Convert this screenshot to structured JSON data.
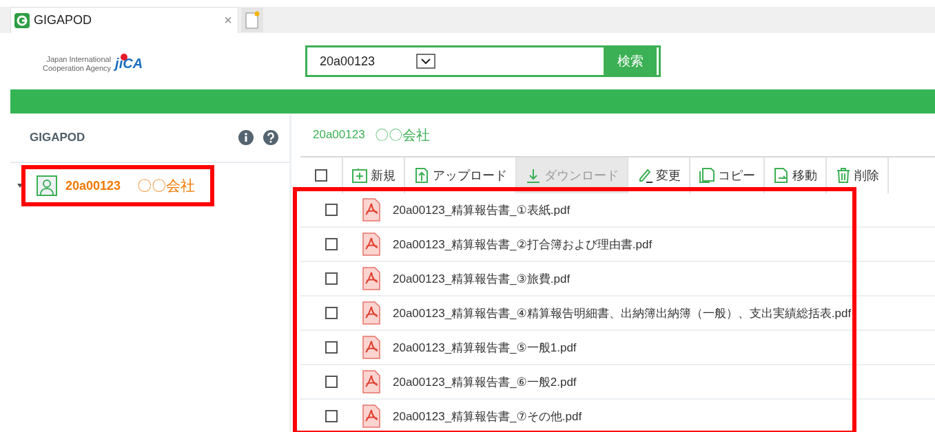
{
  "tab": {
    "title": "GIGAPOD",
    "close": "×"
  },
  "logo": {
    "line1": "Japan International",
    "line2": "Cooperation Agency",
    "mark": "jiCA"
  },
  "search": {
    "value": "20a00123",
    "button": "検索"
  },
  "sidebar": {
    "title": "GIGAPOD",
    "items": [
      {
        "code": "20a00123",
        "name": "〇〇会社",
        "expanded": true,
        "highlighted": true
      }
    ]
  },
  "folder": {
    "code": "20a00123",
    "name": "〇〇会社"
  },
  "toolbar": {
    "select_all": false,
    "buttons": [
      {
        "kind": "new",
        "label": "新規",
        "disabled": false
      },
      {
        "kind": "upload",
        "label": "アップロード",
        "disabled": false
      },
      {
        "kind": "download",
        "label": "ダウンロード",
        "disabled": true
      },
      {
        "kind": "edit",
        "label": "変更",
        "disabled": false
      },
      {
        "kind": "copy",
        "label": "コピー",
        "disabled": false
      },
      {
        "kind": "move",
        "label": "移動",
        "disabled": false
      },
      {
        "kind": "delete",
        "label": "削除",
        "disabled": false
      }
    ]
  },
  "files": [
    {
      "name": "20a00123_精算報告書_①表紙.pdf",
      "checked": false
    },
    {
      "name": "20a00123_精算報告書_②打合簿および理由書.pdf",
      "checked": false
    },
    {
      "name": "20a00123_精算報告書_③旅費.pdf",
      "checked": false
    },
    {
      "name": "20a00123_精算報告書_④精算報告明細書、出納簿出納簿（一般）、支出実績総括表.pdf",
      "checked": false
    },
    {
      "name": "20a00123_精算報告書_⑤一般1.pdf",
      "checked": false
    },
    {
      "name": "20a00123_精算報告書_⑥一般2.pdf",
      "checked": false
    },
    {
      "name": "20a00123_精算報告書_⑦その他.pdf",
      "checked": false
    }
  ],
  "files_highlighted": true
}
